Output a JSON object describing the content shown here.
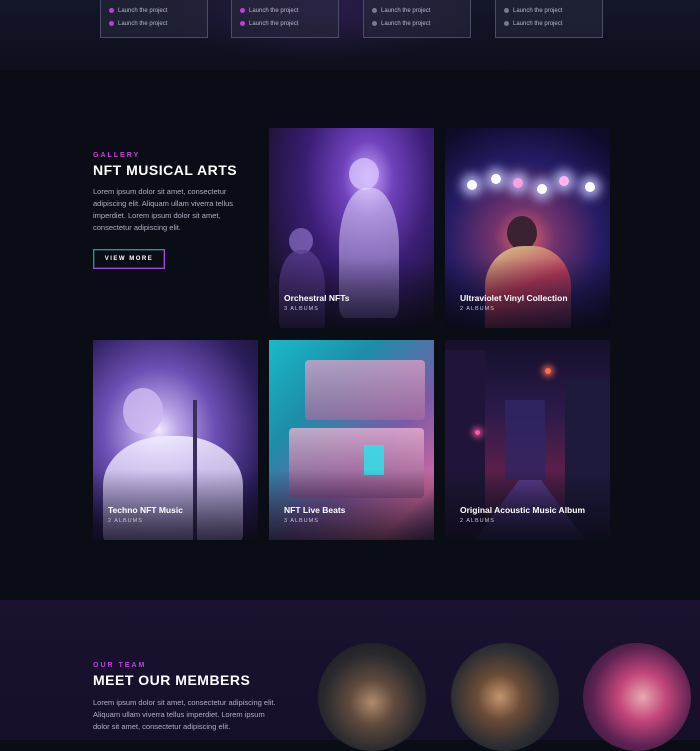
{
  "plans": [
    {
      "lines": [
        "Launch the project",
        "Launch the project"
      ],
      "dot": "purple"
    },
    {
      "lines": [
        "Launch the project",
        "Launch the project"
      ],
      "dot": "purple"
    },
    {
      "lines": [
        "Launch the project",
        "Launch the project"
      ],
      "dot": "grey"
    },
    {
      "lines": [
        "Launch the project",
        "Launch the project"
      ],
      "dot": "grey"
    }
  ],
  "gallery": {
    "eyebrow": "GALLERY",
    "title": "NFT MUSICAL ARTS",
    "description": "Lorem ipsum dolor sit amet, consectetur adipiscing elit. Aliquam ullam viverra tellus imperdiet. Lorem ipsum dolor sit amet, consectetur adipiscing elit.",
    "button_label": "VIEW MORE",
    "items": [
      {
        "title": "Orchestral NFTs",
        "subtitle": "3 ALBUMS"
      },
      {
        "title": "Ultraviolet Vinyl Collection",
        "subtitle": "2 ALBUMS"
      },
      {
        "title": "Techno NFT Music",
        "subtitle": "2 ALBUMS"
      },
      {
        "title": "NFT Live Beats",
        "subtitle": "3 ALBUMS"
      },
      {
        "title": "Original Acoustic Music Album",
        "subtitle": "2 ALBUMS"
      }
    ]
  },
  "team": {
    "eyebrow": "OUR TEAM",
    "title": "MEET OUR MEMBERS",
    "description": "Lorem ipsum dolor sit amet, consectetur adipiscing elit. Aliquam ullam viverra tellus imperdiet. Lorem ipsum dolor sit amet, consectetur adipiscing elit."
  },
  "colors": {
    "accent": "#c63fe0",
    "background": "#0b0d16"
  }
}
